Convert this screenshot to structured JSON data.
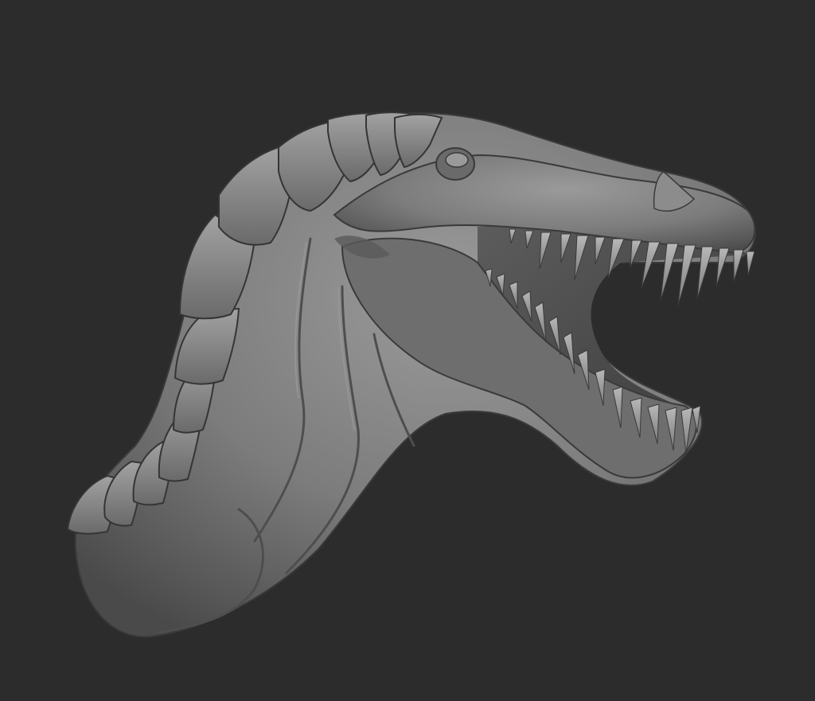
{
  "viewport": {
    "background_color": "#2c2c2c",
    "model": {
      "icon_name": "dinosaur-head-sculpt",
      "material_color": "#7d7d7d",
      "highlight_color": "#a9a9a9",
      "shadow_color": "#3e3e3e"
    }
  }
}
